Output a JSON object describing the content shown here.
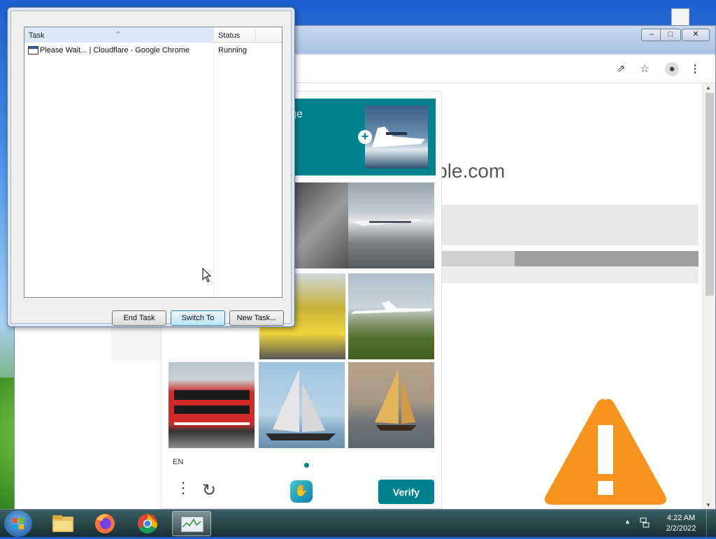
{
  "desktop": {
    "icon_label": ""
  },
  "chrome": {
    "domain_text": "ible.com",
    "window_controls": {
      "minimize": "–",
      "maximize": "□",
      "close": "✕"
    },
    "toolbar_icons": [
      "share-icon",
      "star-icon",
      "profile-icon",
      "more-icon"
    ]
  },
  "captcha": {
    "header_text": "ge",
    "language": "EN",
    "verify_label": "Verify",
    "tiles": [
      "train",
      "airplane",
      "bus",
      "airplane",
      "bus",
      "sailboat",
      "sailboat"
    ]
  },
  "task_manager": {
    "columns": {
      "task": "Task",
      "status": "Status"
    },
    "rows": [
      {
        "task": "Please Wait... | Cloudflare - Google Chrome",
        "status": "Running"
      }
    ],
    "buttons": {
      "end_task": "End Task",
      "switch_to": "Switch To",
      "new_task": "New Task..."
    }
  },
  "taskbar": {
    "apps": [
      "windows-explorer",
      "firefox",
      "chrome",
      "task-manager"
    ],
    "clock": {
      "time": "4:22 AM",
      "date": "2/2/2022"
    }
  },
  "colors": {
    "captcha_accent": "#00838f",
    "warning": "#f7941d"
  }
}
